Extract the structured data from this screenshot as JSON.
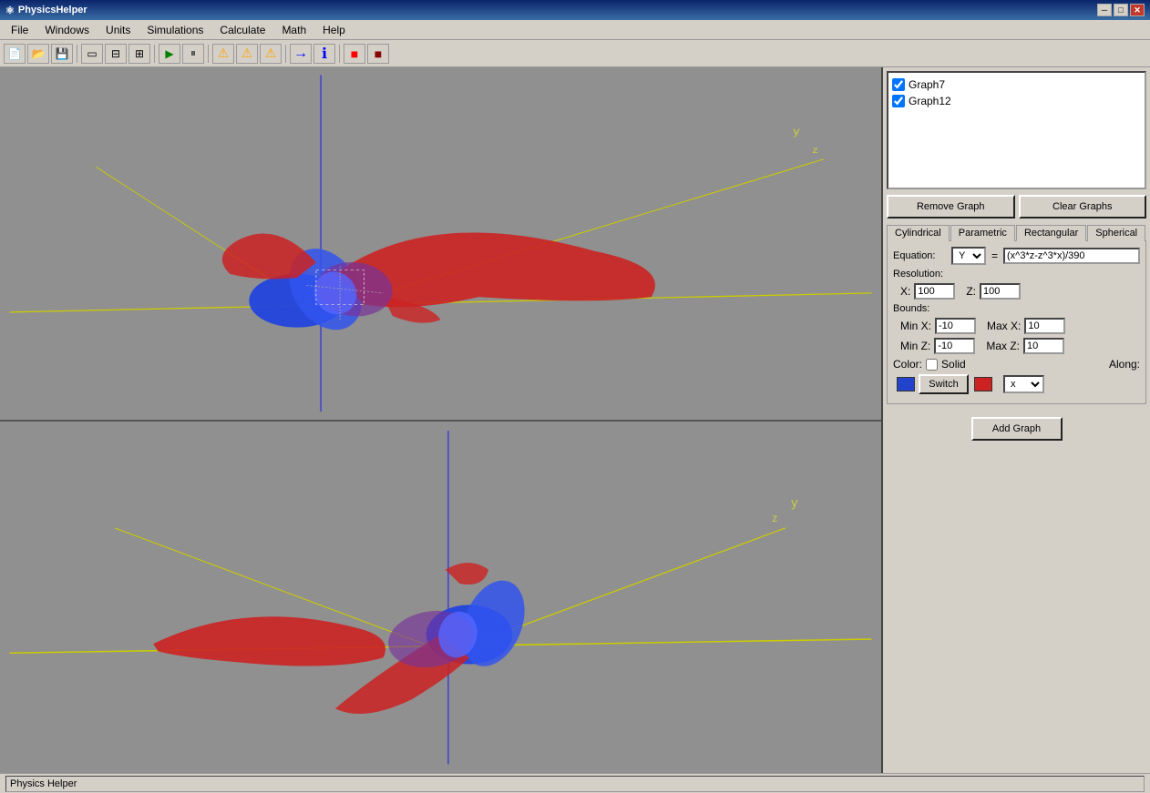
{
  "app": {
    "title": "PhysicsHelper",
    "icon": "⚛"
  },
  "titlebar": {
    "minimize": "─",
    "maximize": "□",
    "close": "✕"
  },
  "menu": {
    "items": [
      "File",
      "Windows",
      "Units",
      "Simulations",
      "Calculate",
      "Math",
      "Help"
    ]
  },
  "toolbar": {
    "buttons": [
      "📄",
      "📂",
      "💾",
      "□",
      "▭",
      "▣",
      "▶",
      "⏸",
      "⚠",
      "⚠",
      "⚠",
      "→",
      "ℹ",
      "■",
      "■"
    ]
  },
  "right_panel": {
    "graphs": [
      {
        "id": "graph7",
        "label": "Graph7",
        "checked": true
      },
      {
        "id": "graph12",
        "label": "Graph12",
        "checked": true
      }
    ],
    "buttons": {
      "remove": "Remove Graph",
      "clear": "Clear Graphs"
    },
    "tabs": [
      "Cylindrical",
      "Parametric",
      "Rectangular",
      "Spherical"
    ],
    "active_tab": "Rectangular",
    "equation": {
      "label": "Equation:",
      "var": "Y",
      "equals": "=",
      "formula": "(x^3*z-z^3*x)/390"
    },
    "resolution": {
      "label": "Resolution:",
      "x_label": "X:",
      "x_value": "100",
      "z_label": "Z:",
      "z_value": "100"
    },
    "bounds": {
      "label": "Bounds:",
      "min_x_label": "Min X:",
      "min_x_value": "-10",
      "max_x_label": "Max X:",
      "max_x_value": "10",
      "min_z_label": "Min Z:",
      "min_z_value": "-10",
      "max_z_label": "Max Z:",
      "max_z_value": "10"
    },
    "color": {
      "label": "Color:",
      "solid_label": "Solid",
      "swatch1": "#2244cc",
      "switch_label": "Switch",
      "swatch2": "#cc2222",
      "along_label": "Along:",
      "along_value": "x"
    },
    "add_graph": "Add Graph"
  },
  "viewport": {
    "info_text": "PhysicsHelper",
    "top": {
      "y_axis_label": "y",
      "z_axis_label": "z"
    },
    "bottom": {
      "y_axis_label": "y",
      "z_axis_label": "z"
    }
  },
  "status": {
    "text": "Physics Helper"
  }
}
